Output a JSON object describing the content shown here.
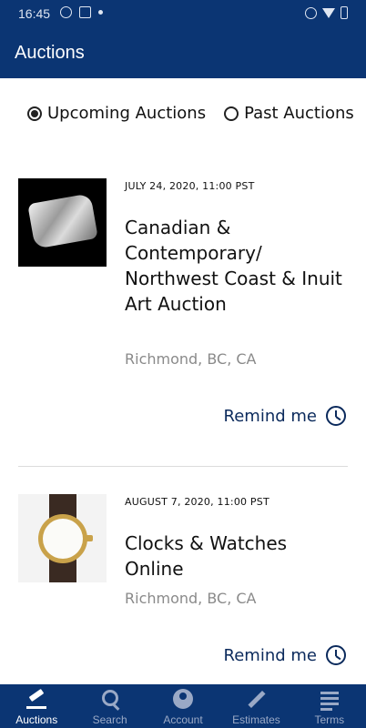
{
  "status_bar": {
    "time": "16:45"
  },
  "app_bar": {
    "title": "Auctions"
  },
  "filter": {
    "options": [
      {
        "label": "Upcoming Auctions",
        "selected": true
      },
      {
        "label": "Past Auctions",
        "selected": false
      }
    ]
  },
  "auctions": [
    {
      "date": "JULY 24, 2020, 11:00 PST",
      "title": "Canadian & Contemporary/ Northwest Coast & Inuit Art Auction",
      "location": "Richmond, BC, CA",
      "remind_label": "Remind me",
      "image_icon": "silver-cuff-bracelet"
    },
    {
      "date": "AUGUST 7, 2020, 11:00 PST",
      "title": "Clocks & Watches Online",
      "location": "Richmond, BC, CA",
      "remind_label": "Remind me",
      "image_icon": "gold-wristwatch"
    }
  ],
  "bottom_nav": [
    {
      "label": "Auctions",
      "icon": "gavel-icon",
      "active": true
    },
    {
      "label": "Search",
      "icon": "search-icon",
      "active": false
    },
    {
      "label": "Account",
      "icon": "account-icon",
      "active": false
    },
    {
      "label": "Estimates",
      "icon": "pencil-icon",
      "active": false
    },
    {
      "label": "Terms",
      "icon": "document-icon",
      "active": false
    }
  ],
  "colors": {
    "primary": "#0b3573",
    "accent_text": "#0b2a5c",
    "muted_text": "#8a8a8a"
  }
}
